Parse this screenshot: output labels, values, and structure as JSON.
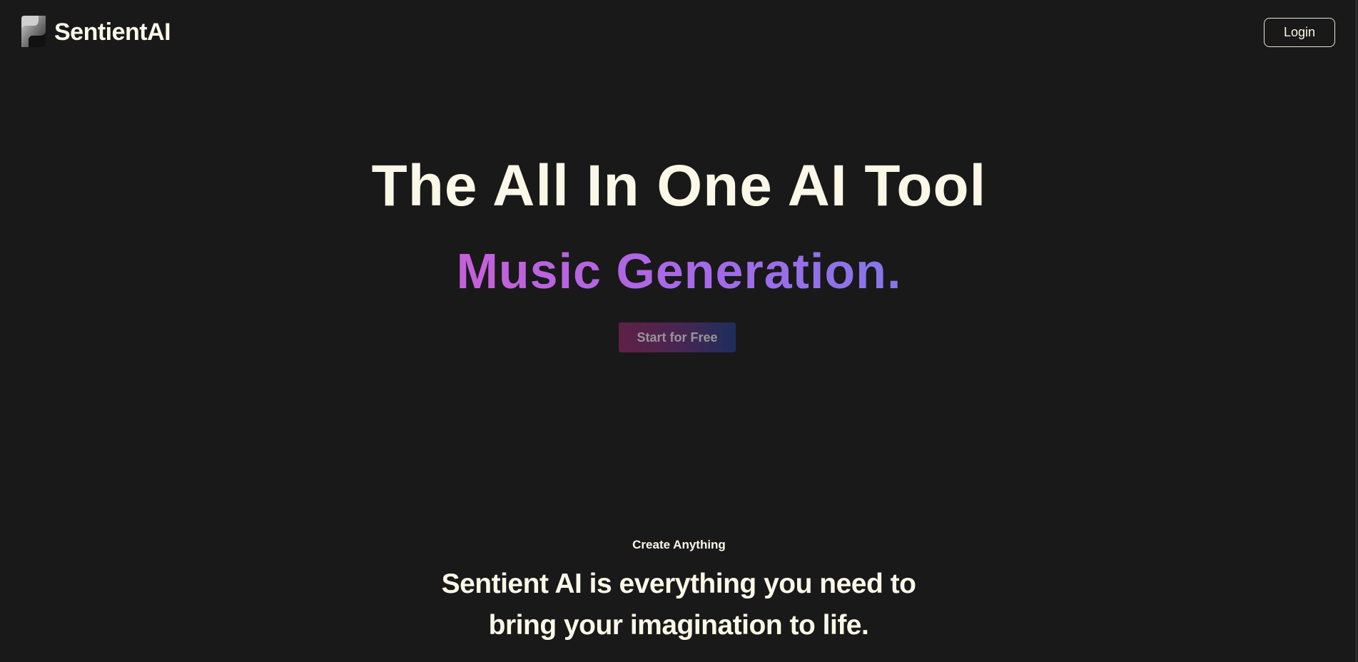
{
  "header": {
    "brand_name": "SentientAI",
    "logo_icon": "sentient-s-logo-icon",
    "login_label": "Login"
  },
  "hero": {
    "title": "The All In One AI Tool",
    "subtitle": "Music Generation.",
    "cta_label": "Start for Free"
  },
  "section": {
    "eyebrow": "Create Anything",
    "heading": "Sentient AI is everything you need to bring your imagination to life."
  },
  "colors": {
    "background": "#191919",
    "text": "#fbf8e8",
    "gradient_start": "#c760d9",
    "gradient_end": "#8477e8",
    "cta_start": "#5e2145",
    "cta_end": "#1d2e5c"
  }
}
